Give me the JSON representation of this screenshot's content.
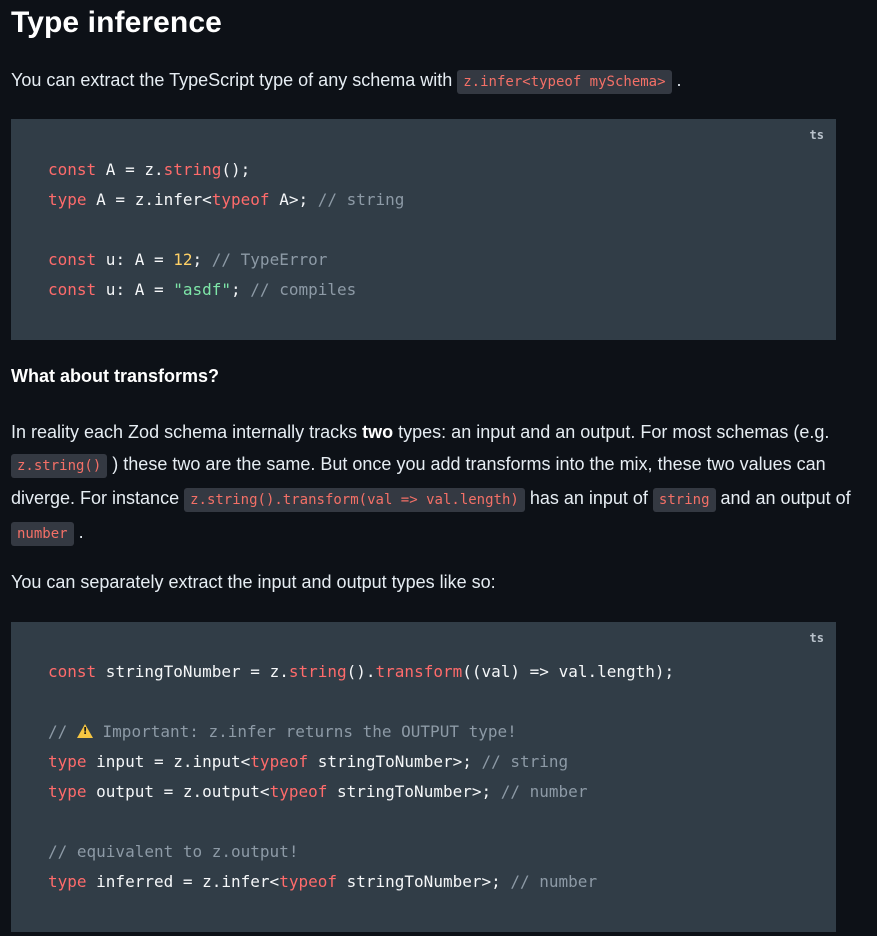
{
  "heading": "Type inference",
  "intro": {
    "text_before": "You can extract the TypeScript type of any schema with ",
    "code": "z.infer<typeof mySchema>",
    "text_after": " ."
  },
  "code_block_1": {
    "lang": "ts",
    "lines": [
      [
        {
          "t": "kw",
          "v": "const"
        },
        {
          "t": "p",
          "v": " A = z."
        },
        {
          "t": "fn",
          "v": "string"
        },
        {
          "t": "p",
          "v": "();"
        }
      ],
      [
        {
          "t": "kw",
          "v": "type"
        },
        {
          "t": "p",
          "v": " A = z.infer<"
        },
        {
          "t": "kw",
          "v": "typeof"
        },
        {
          "t": "p",
          "v": " A>; "
        },
        {
          "t": "cm",
          "v": "// string"
        }
      ],
      [],
      [
        {
          "t": "kw",
          "v": "const"
        },
        {
          "t": "p",
          "v": " u: A = "
        },
        {
          "t": "num",
          "v": "12"
        },
        {
          "t": "p",
          "v": "; "
        },
        {
          "t": "cm",
          "v": "// TypeError"
        }
      ],
      [
        {
          "t": "kw",
          "v": "const"
        },
        {
          "t": "p",
          "v": " u: A = "
        },
        {
          "t": "str",
          "v": "\"asdf\""
        },
        {
          "t": "p",
          "v": "; "
        },
        {
          "t": "cm",
          "v": "// compiles"
        }
      ]
    ]
  },
  "subheading": "What about transforms?",
  "para2": {
    "s1": "In reality each Zod schema internally tracks ",
    "bold": "two",
    "s2": " types: an input and an output. For most schemas (e.g. ",
    "c1": "z.string()",
    "s3": " ) these two are the same. But once you add transforms into the mix, these two values can diverge. For instance ",
    "c2": "z.string().transform(val => val.length)",
    "s4": " has an input of ",
    "c3": "string",
    "s5": " and an output of ",
    "c4": "number",
    "s6": " ."
  },
  "para3": "You can separately extract the input and output types like so:",
  "code_block_2": {
    "lang": "ts",
    "lines": [
      [
        {
          "t": "kw",
          "v": "const"
        },
        {
          "t": "p",
          "v": " stringToNumber = z."
        },
        {
          "t": "fn",
          "v": "string"
        },
        {
          "t": "p",
          "v": "()."
        },
        {
          "t": "fn",
          "v": "transform"
        },
        {
          "t": "p",
          "v": "((val) => val.length);"
        }
      ],
      [],
      [
        {
          "t": "cm",
          "v": "// "
        },
        {
          "t": "warn",
          "v": ""
        },
        {
          "t": "cm",
          "v": " Important: z.infer returns the OUTPUT type!"
        }
      ],
      [
        {
          "t": "kw",
          "v": "type"
        },
        {
          "t": "p",
          "v": " input = z.input<"
        },
        {
          "t": "kw",
          "v": "typeof"
        },
        {
          "t": "p",
          "v": " stringToNumber>; "
        },
        {
          "t": "cm",
          "v": "// string"
        }
      ],
      [
        {
          "t": "kw",
          "v": "type"
        },
        {
          "t": "p",
          "v": " output = z.output<"
        },
        {
          "t": "kw",
          "v": "typeof"
        },
        {
          "t": "p",
          "v": " stringToNumber>; "
        },
        {
          "t": "cm",
          "v": "// number"
        }
      ],
      [],
      [
        {
          "t": "cm",
          "v": "// equivalent to z.output!"
        }
      ],
      [
        {
          "t": "kw",
          "v": "type"
        },
        {
          "t": "p",
          "v": " inferred = z.infer<"
        },
        {
          "t": "kw",
          "v": "typeof"
        },
        {
          "t": "p",
          "v": " stringToNumber>; "
        },
        {
          "t": "cm",
          "v": "// number"
        }
      ]
    ]
  },
  "icons": {
    "warning": "warning-triangle-icon"
  }
}
